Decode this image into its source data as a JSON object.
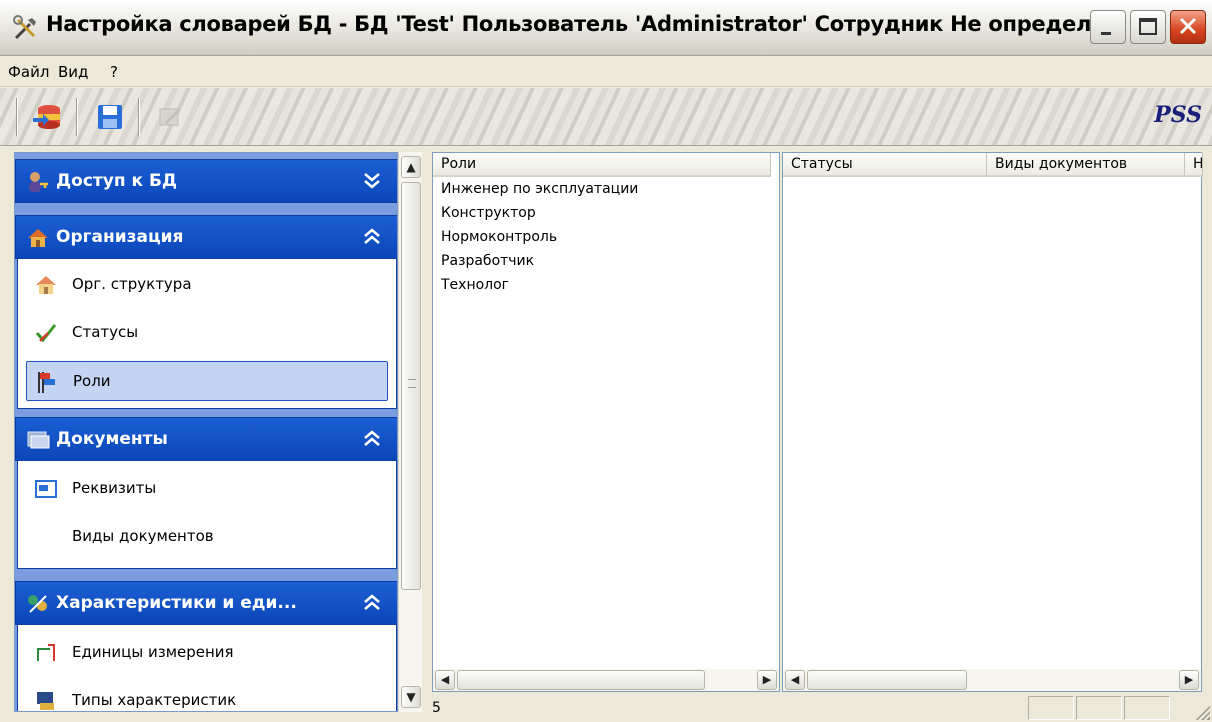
{
  "window": {
    "title": "Настройка словарей БД - БД 'Test' Пользователь 'Administrator' Сотрудник Не определен",
    "icon": "tools-icon"
  },
  "menu": [
    "Файл",
    "Вид",
    "?"
  ],
  "toolbar": {
    "buttons": [
      "database-connect-icon",
      "save-icon",
      "disabled-tool-icon"
    ],
    "brand": "PSS"
  },
  "nav": {
    "groups": [
      {
        "label": "Доступ к БД",
        "icon": "users-key-icon",
        "expanded": false,
        "items": []
      },
      {
        "label": "Организация",
        "icon": "house-icon",
        "expanded": true,
        "items": [
          {
            "label": "Орг. структура",
            "icon": "house-icon"
          },
          {
            "label": "Статусы",
            "icon": "checkmark-icon"
          },
          {
            "label": "Роли",
            "icon": "flags-icon",
            "selected": true
          }
        ]
      },
      {
        "label": "Документы",
        "icon": "documents-icon",
        "expanded": true,
        "items": [
          {
            "label": "Реквизиты",
            "icon": "field-icon"
          },
          {
            "label": "Виды документов",
            "icon": ""
          }
        ]
      },
      {
        "label": "Характеристики и еди...",
        "icon": "characteristics-icon",
        "expanded": true,
        "items": [
          {
            "label": "Единицы измерения",
            "icon": "measure-icon"
          },
          {
            "label": "Типы характеристик",
            "icon": "types-icon"
          }
        ]
      }
    ]
  },
  "roles_list": {
    "header": "Роли",
    "items": [
      "Инженер по эксплуатации",
      "Конструктор",
      "Нормоконтроль",
      "Разработчик",
      "Технолог"
    ]
  },
  "grid": {
    "columns": [
      "Статусы",
      "Виды документов",
      "Н"
    ]
  },
  "status": {
    "count": "5"
  },
  "colors": {
    "nav_header": "#0a47b8",
    "selected_item": "#c3d5f3",
    "close_button": "#d7431f"
  }
}
